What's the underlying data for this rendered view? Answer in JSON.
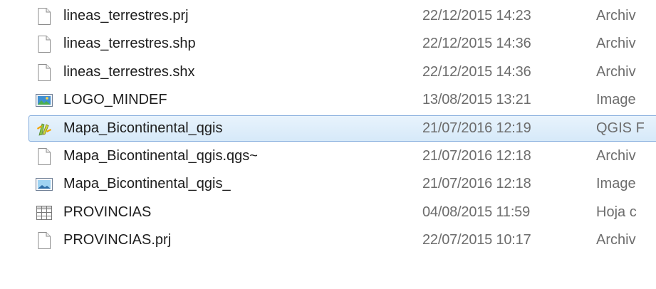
{
  "files": [
    {
      "name": "lineas_terrestres.prj",
      "date": "22/12/2015 14:23",
      "type": "Archiv",
      "icon": "generic-file-icon",
      "selected": false
    },
    {
      "name": "lineas_terrestres.shp",
      "date": "22/12/2015 14:36",
      "type": "Archiv",
      "icon": "generic-file-icon",
      "selected": false
    },
    {
      "name": "lineas_terrestres.shx",
      "date": "22/12/2015 14:36",
      "type": "Archiv",
      "icon": "generic-file-icon",
      "selected": false
    },
    {
      "name": "LOGO_MINDEF",
      "date": "13/08/2015 13:21",
      "type": "Image",
      "icon": "image-file-icon",
      "selected": false
    },
    {
      "name": "Mapa_Bicontinental_qgis",
      "date": "21/07/2016 12:19",
      "type": "QGIS F",
      "icon": "qgis-icon",
      "selected": true
    },
    {
      "name": "Mapa_Bicontinental_qgis.qgs~",
      "date": "21/07/2016 12:18",
      "type": "Archiv",
      "icon": "generic-file-icon",
      "selected": false
    },
    {
      "name": "Mapa_Bicontinental_qgis_",
      "date": "21/07/2016 12:18",
      "type": "Image",
      "icon": "landscape-image-icon",
      "selected": false
    },
    {
      "name": "PROVINCIAS",
      "date": "04/08/2015 11:59",
      "type": "Hoja c",
      "icon": "spreadsheet-icon",
      "selected": false
    },
    {
      "name": "PROVINCIAS.prj",
      "date": "22/07/2015 10:17",
      "type": "Archiv",
      "icon": "generic-file-icon",
      "selected": false
    }
  ],
  "colors": {
    "selection_bg": "#d6e9f9",
    "selection_border": "#84acdd",
    "name_text": "#1e1e1e",
    "meta_text": "#6d6d6d"
  }
}
